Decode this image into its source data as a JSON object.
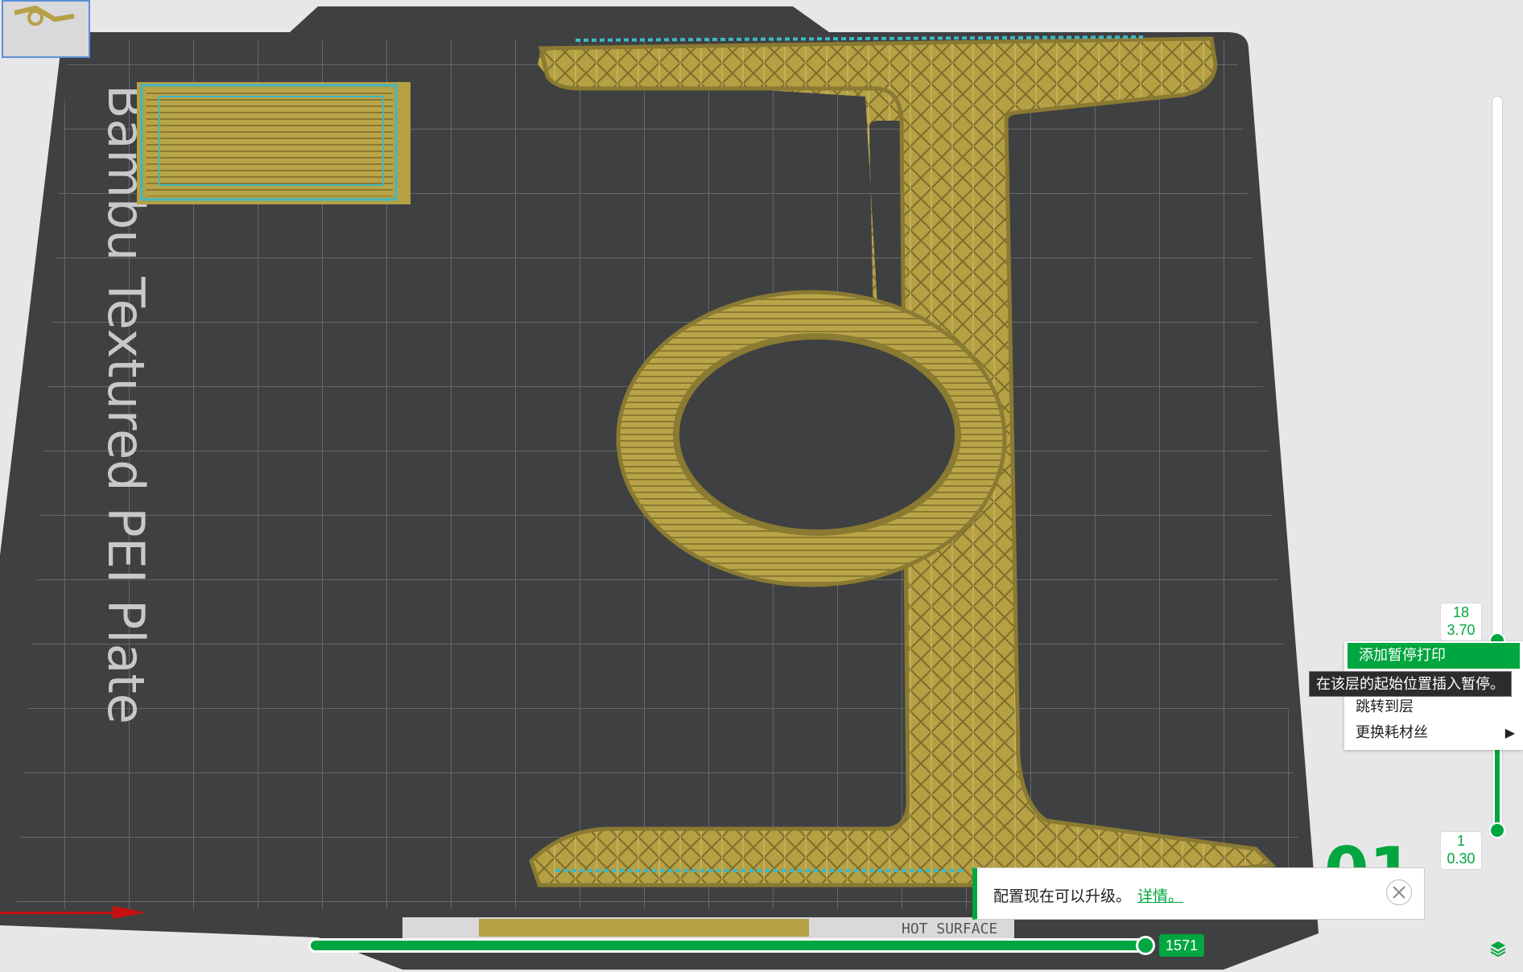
{
  "plate": {
    "name": "Bambu Textured PEI Plate",
    "bed_label_fragment": "HOT SURFACE",
    "plate_number_partial": "01"
  },
  "layer_slider": {
    "top_layer": "18",
    "top_height": "3.70",
    "bottom_layer": "1",
    "bottom_height": "0.30"
  },
  "context_menu": {
    "items": [
      {
        "label": "添加暂停打印"
      },
      {
        "label": "跳转到层"
      },
      {
        "label": "更换耗材丝"
      }
    ],
    "tooltip": "在该层的起始位置插入暂停。"
  },
  "notification": {
    "text": "配置现在可以升级。",
    "link": "详情。"
  },
  "move_slider": {
    "value": "1571"
  },
  "colors": {
    "accent": "#00a63f",
    "plate": "#3f4041",
    "filament": "#b5a044",
    "travel": "#3fb7c4"
  },
  "icons": {
    "close": "close-icon",
    "layers": "layers-icon",
    "submenu": "triangle-right-icon"
  }
}
